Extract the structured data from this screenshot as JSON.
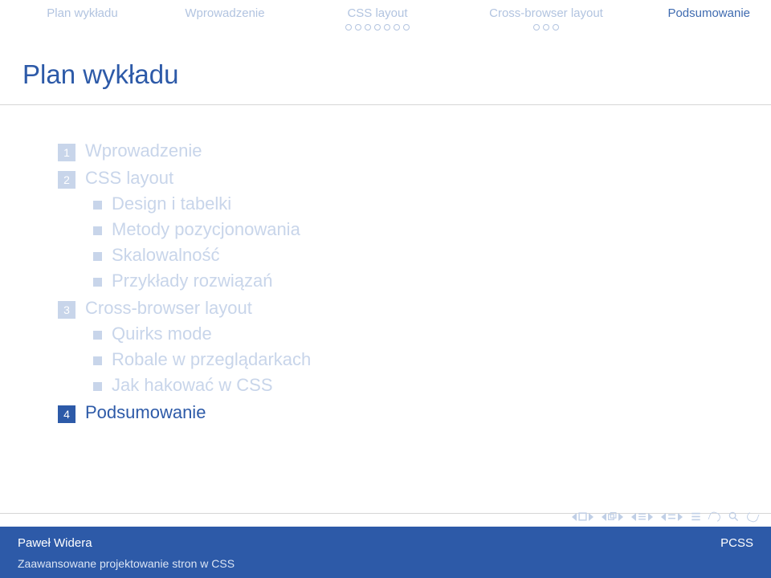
{
  "nav": {
    "items": [
      {
        "label": "Plan wykładu",
        "active": false,
        "dots": 0
      },
      {
        "label": "Wprowadzenie",
        "active": false,
        "dots": 0
      },
      {
        "label": "CSS layout",
        "active": false,
        "dots": 7
      },
      {
        "label": "Cross-browser layout",
        "active": false,
        "dots": 3
      },
      {
        "label": "Podsumowanie",
        "active": true,
        "dots": 0
      }
    ]
  },
  "title": "Plan wykładu",
  "outline": [
    {
      "num": "1",
      "label": "Wprowadzenie",
      "active": false,
      "subs": []
    },
    {
      "num": "2",
      "label": "CSS layout",
      "active": false,
      "subs": [
        "Design i tabelki",
        "Metody pozycjonowania",
        "Skalowalność",
        "Przykłady rozwiązań"
      ]
    },
    {
      "num": "3",
      "label": "Cross-browser layout",
      "active": false,
      "subs": [
        "Quirks mode",
        "Robale w przeglądarkach",
        "Jak hakować w CSS"
      ]
    },
    {
      "num": "4",
      "label": "Podsumowanie",
      "active": true,
      "subs": []
    }
  ],
  "footer": {
    "author": "Paweł Widera",
    "subtitle": "Zaawansowane projektowanie stron w CSS",
    "institution": "PCSS"
  }
}
